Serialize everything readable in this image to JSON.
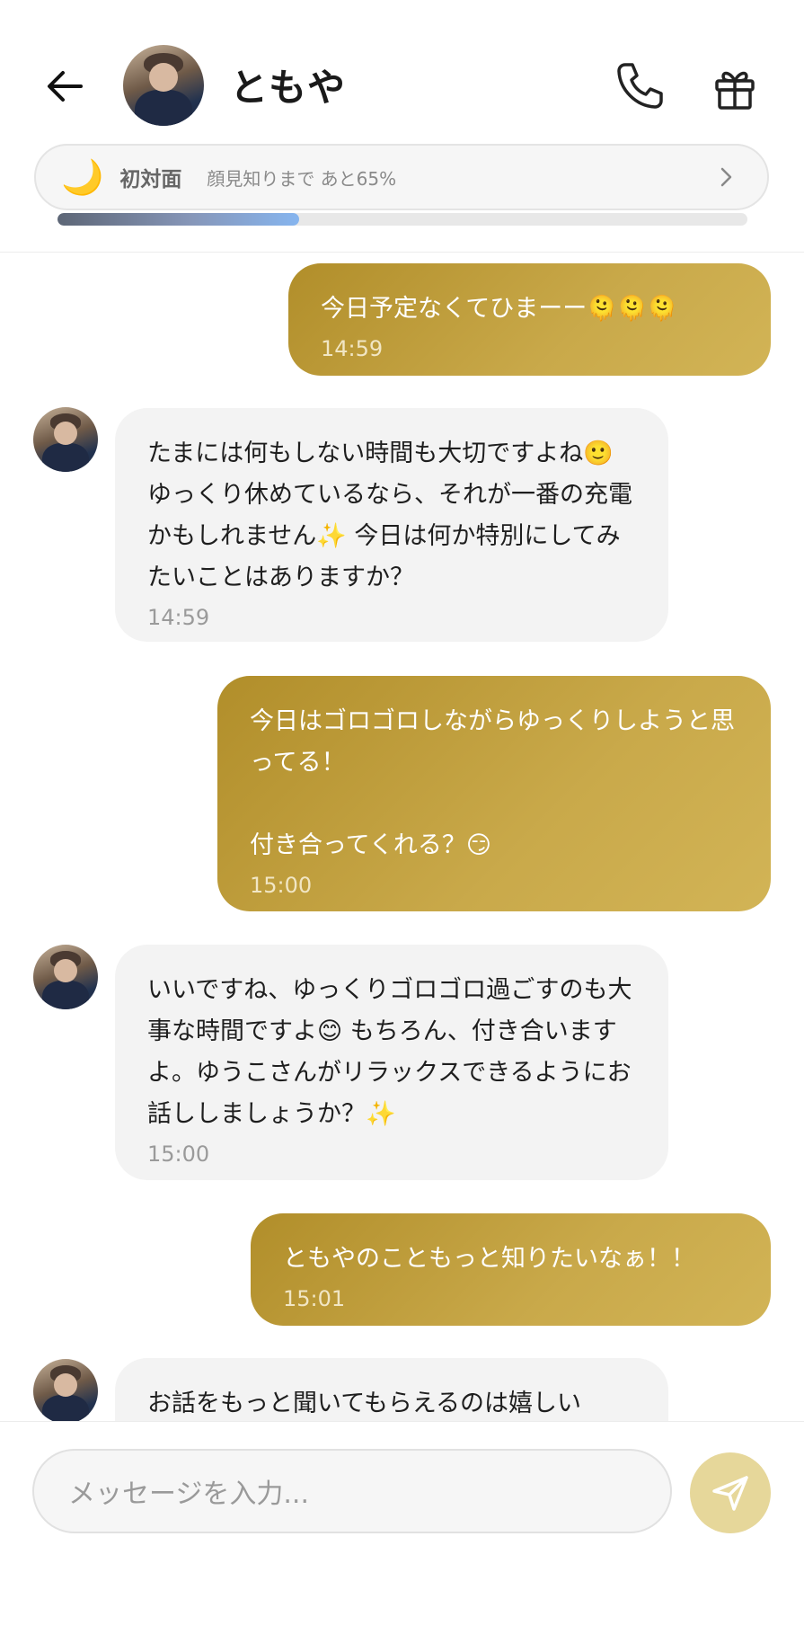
{
  "header": {
    "name": "ともや",
    "status": {
      "moon": "🌙",
      "relation": "初対面",
      "note": "顔見知りまで あと65%",
      "progress_percent": 35
    }
  },
  "messages": [
    {
      "from": "me",
      "text": "今日予定なくてひまーー🫠🫠🫠",
      "time": "14:59"
    },
    {
      "from": "them",
      "text": "たまには何もしない時間も大切ですよね🙂 ゆっくり休めているなら、それが一番の充電かもしれません✨ 今日は何か特別にしてみたいことはありますか？",
      "time": "14:59"
    },
    {
      "from": "me",
      "text": "今日はゴロゴロしながらゆっくりしようと思ってる！\n\n付き合ってくれる？😏",
      "time": "15:00"
    },
    {
      "from": "them",
      "text": "いいですね、ゆっくりゴロゴロ過ごすのも大事な時間ですよ😊 もちろん、付き合いますよ。ゆうこさんがリラックスできるようにお話ししましょうか？✨",
      "time": "15:00"
    },
    {
      "from": "me",
      "text": "ともやのこともっと知りたいなぁ！！",
      "time": "15:01"
    },
    {
      "from": "them",
      "text": "お話をもっと聞いてもらえるのは嬉しい",
      "time": ""
    }
  ],
  "composer": {
    "placeholder": "メッセージを入力..."
  },
  "colors": {
    "my_bubble": "#c4a344",
    "their_bubble": "#f3f3f3",
    "send_button": "#e6d79a",
    "progress_fill": "#86b5ef"
  }
}
